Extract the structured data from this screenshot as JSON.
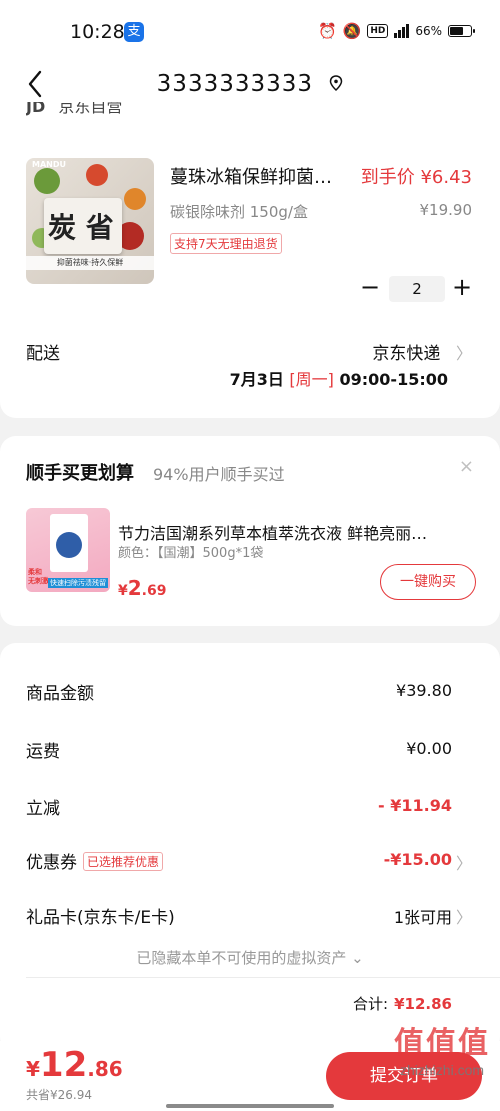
{
  "status_bar": {
    "time": "10:28",
    "app_icon_glyph": "支",
    "battery_text": "66%",
    "battery_level": 0.66,
    "network": "5G"
  },
  "header": {
    "title": "3333333333"
  },
  "shop": {
    "name": "京东自营",
    "logo": "JD"
  },
  "product": {
    "name": "蔓珠冰箱保鲜抑菌…",
    "final_price": "到手价 ¥6.43",
    "spec": "碳银除味剂 150g/盒",
    "original_price": "¥19.90",
    "return_tag": "支持7天无理由退货",
    "image_brand": "MANDU",
    "image_strip_text": "抑菌祛味·持久保鲜",
    "image_glyph": "炭 省",
    "quantity": "2",
    "minus": "−",
    "plus": "+"
  },
  "delivery": {
    "label": "配送",
    "method": "京东快递",
    "date": "7月3日",
    "weekday": "[周一]",
    "window": "09:00-15:00"
  },
  "upsell": {
    "title": "顺手买更划算",
    "subtitle": "94%用户顺手买过",
    "close": "×",
    "product_name": "节力洁国潮系列草本植萃洗衣液 鲜艳亮丽…",
    "attr": "颜色：【国潮】500g*1袋",
    "price_currency": "¥",
    "price_int": "2",
    "price_dec": ".69",
    "buy_label": "一键购买",
    "image_label1": "柔和\n无刺激",
    "image_label2": "快速扫除污渍残留"
  },
  "summary": {
    "goods_label": "商品金额",
    "goods_value": "¥39.80",
    "shipping_label": "运费",
    "shipping_value": "¥0.00",
    "discount_label": "立减",
    "discount_value": "- ¥11.94",
    "coupon_label": "优惠券",
    "coupon_tag": "已选推荐优惠",
    "coupon_value": "-¥15.00",
    "giftcard_label": "礼品卡(京东卡/E卡)",
    "giftcard_value": "1张可用",
    "hidden_assets": "已隐藏本单不可使用的虚拟资产 ⌄",
    "total_label": "合计:",
    "total_value": "¥12.86"
  },
  "bottom": {
    "currency": "¥",
    "amount_int": "12",
    "amount_dec": ".86",
    "saved": "共省¥26.94",
    "submit": "提交订单"
  },
  "watermark": {
    "logo": "值值值",
    "text": "zhizhizhi.com"
  },
  "colors": {
    "accent": "#e4393c",
    "background": "#f2f2f2",
    "card": "#ffffff",
    "muted": "#888888"
  }
}
